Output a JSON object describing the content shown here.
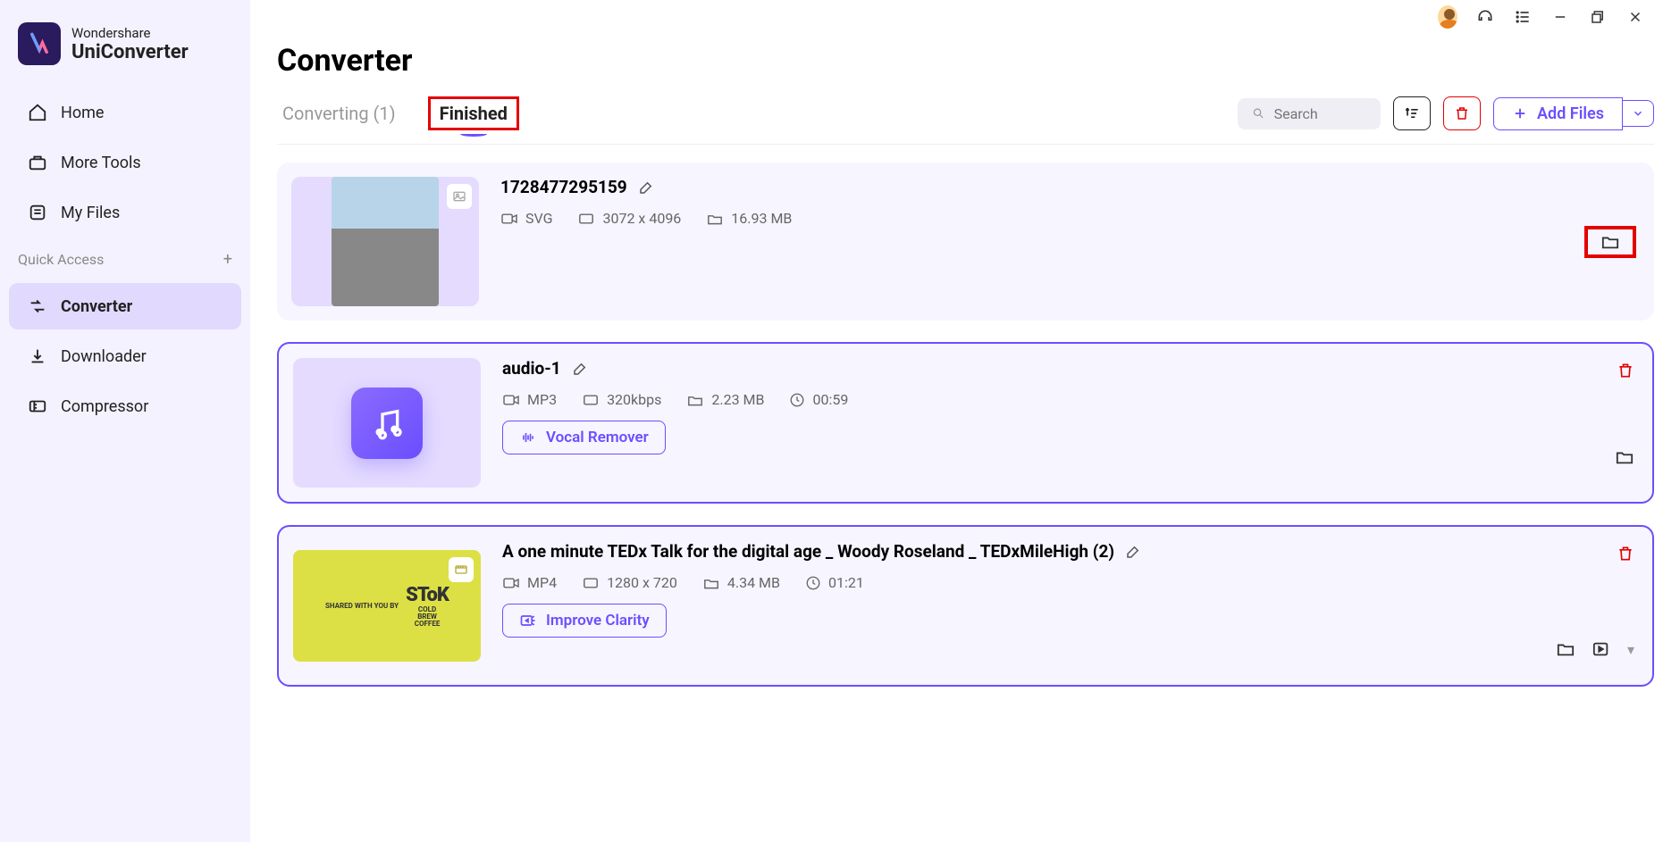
{
  "app": {
    "brand_top": "Wondershare",
    "brand_bottom": "UniConverter",
    "page_title": "Converter"
  },
  "sidebar": {
    "items": [
      {
        "label": "Home"
      },
      {
        "label": "More Tools"
      },
      {
        "label": "My Files"
      }
    ],
    "quick_access": "Quick Access",
    "quick_items": [
      {
        "label": "Converter"
      },
      {
        "label": "Downloader"
      },
      {
        "label": "Compressor"
      }
    ]
  },
  "tabs": {
    "converting": "Converting (1)",
    "finished": "Finished"
  },
  "toolbar": {
    "search_placeholder": "Search",
    "add_files": "Add Files"
  },
  "files": [
    {
      "name": "1728477295159",
      "format": "SVG",
      "resolution": "3072 x 4096",
      "size": "16.93 MB"
    },
    {
      "name": "audio-1",
      "format": "MP3",
      "bitrate": "320kbps",
      "size": "2.23 MB",
      "duration": "00:59",
      "action": "Vocal Remover"
    },
    {
      "name": "A one minute TEDx Talk for the digital age _ Woody Roseland _ TEDxMileHigh (2)",
      "format": "MP4",
      "resolution": "1280 x 720",
      "size": "4.34 MB",
      "duration": "01:21",
      "action": "Improve Clarity"
    }
  ],
  "thumb_video": {
    "shared": "SHARED WITH YOU BY",
    "brand": "SToK",
    "line1": "COLD",
    "line2": "BREW",
    "line3": "COFFEE"
  }
}
